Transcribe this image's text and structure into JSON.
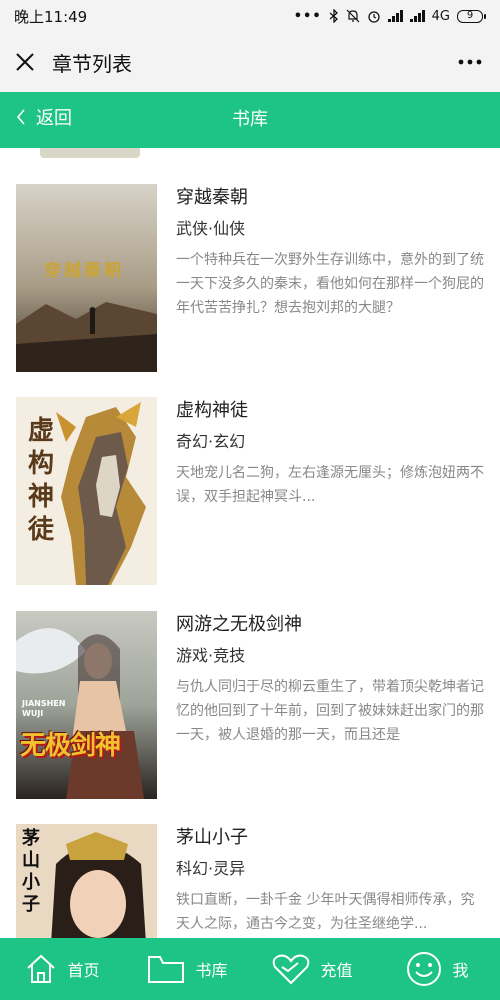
{
  "status_bar": {
    "time": "晚上11:49",
    "network": "4G",
    "battery": "9"
  },
  "wechat_header": {
    "title": "章节列表"
  },
  "nav": {
    "back_label": "返回",
    "title": "书库"
  },
  "books": [
    {
      "title": "穿越秦朝",
      "tag": "武侠·仙侠",
      "description": "一个特种兵在一次野外生存训练中，意外的到了统一天下没多久的秦末，看他如何在那样一个狗屁的年代苦苦挣扎？想去抱刘邦的大腿？",
      "cover_text": "穿越秦朝"
    },
    {
      "title": "虚构神徒",
      "tag": "奇幻·玄幻",
      "description": "天地宠儿名二狗，左右逢源无厘头；修炼泡妞两不误，双手担起神冥斗...",
      "cover_text": "虚构神徒"
    },
    {
      "title": "网游之无极剑神",
      "tag": "游戏·竞技",
      "description": "与仇人同归于尽的柳云重生了，带着顶尖乾坤者记忆的他回到了十年前，回到了被妹妹赶出家门的那一天，被人退婚的那一天，而且还是",
      "cover_text": "无极剑神",
      "cover_subtext": "JIANSHEN WUJI"
    },
    {
      "title": "茅山小子",
      "tag": "科幻·灵异",
      "description": "铁口直断，一卦千金 少年叶天偶得相师传承，究天人之际，通古今之变，为往圣继绝学...",
      "cover_text": "茅山小子"
    }
  ],
  "tab_bar": {
    "items": [
      {
        "label": "首页",
        "icon": "home-icon"
      },
      {
        "label": "书库",
        "icon": "folder-icon"
      },
      {
        "label": "充值",
        "icon": "recharge-icon"
      },
      {
        "label": "我",
        "icon": "smiley-icon"
      }
    ]
  },
  "colors": {
    "accent_green": "#1ec486",
    "header_bg": "#f3f3f3",
    "desc_gray": "#888888"
  }
}
